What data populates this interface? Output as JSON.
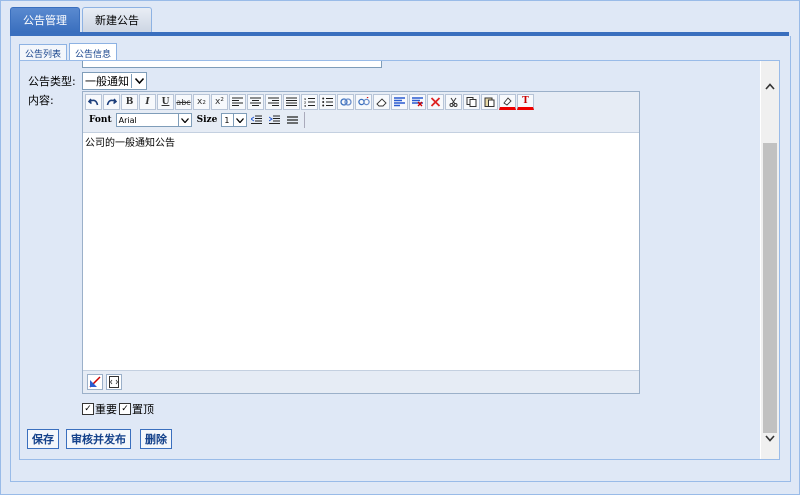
{
  "tabs_top": [
    {
      "label": "公告管理",
      "active": true
    },
    {
      "label": "新建公告",
      "active": false
    }
  ],
  "tabs_inner": [
    {
      "label": "公告列表",
      "active": false
    },
    {
      "label": "公告信息",
      "active": true
    }
  ],
  "form": {
    "type_label": "公告类型:",
    "type_value": "一般通知",
    "content_label": "内容:"
  },
  "toolbar": {
    "font_label": "Font",
    "font_value": "Arial",
    "size_label": "Size",
    "size_value": "1",
    "strike_text": "abc",
    "bold_text": "B",
    "italic_text": "I",
    "underline_text": "U",
    "sub_text": "x₂",
    "sup_text": "x²"
  },
  "editor": {
    "content": "公司的一般通知公告"
  },
  "checkboxes": [
    {
      "label": "重要",
      "checked": true
    },
    {
      "label": "置顶",
      "checked": true
    }
  ],
  "buttons": {
    "save": "保存",
    "review_publish": "审核并发布",
    "delete": "删除"
  },
  "colors": {
    "accent": "#3a6fbe",
    "panel_bg": "#dfe8f6"
  }
}
